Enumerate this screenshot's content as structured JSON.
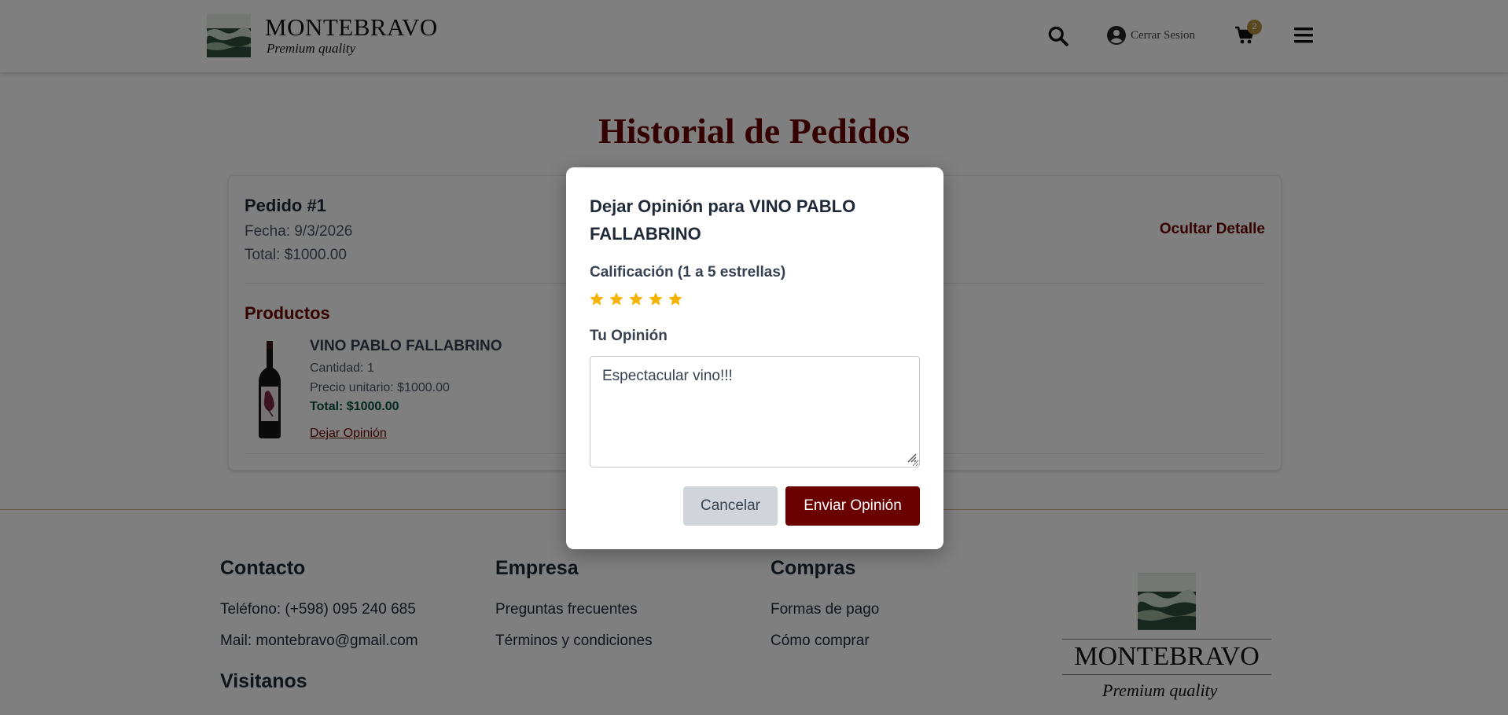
{
  "header": {
    "brand_name": "MONTEBRAVO",
    "brand_tagline": "Premium quality",
    "account_label": "Cerrar Sesion",
    "cart_count": "2",
    "icons": [
      "search-icon",
      "user-icon",
      "cart-icon",
      "menu-icon"
    ]
  },
  "main": {
    "title": "Historial de Pedidos",
    "order": {
      "number": "Pedido #1",
      "date": "Fecha: 9/3/2026",
      "total": "Total: $1000.00",
      "toggle_label": "Ocultar Detalle",
      "products_title": "Productos",
      "product": {
        "name": "VINO PABLO FALLABRINO",
        "quantity": "Cantidad: 1",
        "unit_price": "Precio unitario: $1000.00",
        "total": "Total: $1000.00",
        "review_link": "Dejar Opinión"
      }
    }
  },
  "footer": {
    "contact_title": "Contacto",
    "phone": "Teléfono: (+598) 095 240 685",
    "mail": "Mail: montebravo@gmail.com",
    "visitors_title": "Visitanos",
    "company_title": "Empresa",
    "faq": "Preguntas frecuentes",
    "terms": "Términos y condiciones",
    "purchases_title": "Compras",
    "payment": "Formas de pago",
    "how_to_buy": "Cómo comprar",
    "brand_name": "MONTEBRAVO",
    "brand_tagline": "Premium quality"
  },
  "modal": {
    "title": "Dejar Opinión para VINO PABLO FALLABRINO",
    "rating_label": "Calificación (1 a 5 estrellas)",
    "rating": 5,
    "rating_max": 5,
    "opinion_label": "Tu Opinión",
    "opinion_value": "Espectacular vino!!!",
    "cancel_label": "Cancelar",
    "submit_label": "Enviar Opinión"
  },
  "colors": {
    "accent": "#6b0000",
    "star": "#f5b301",
    "badge": "#b38f3e",
    "logo_green": "#2f4f3f"
  }
}
